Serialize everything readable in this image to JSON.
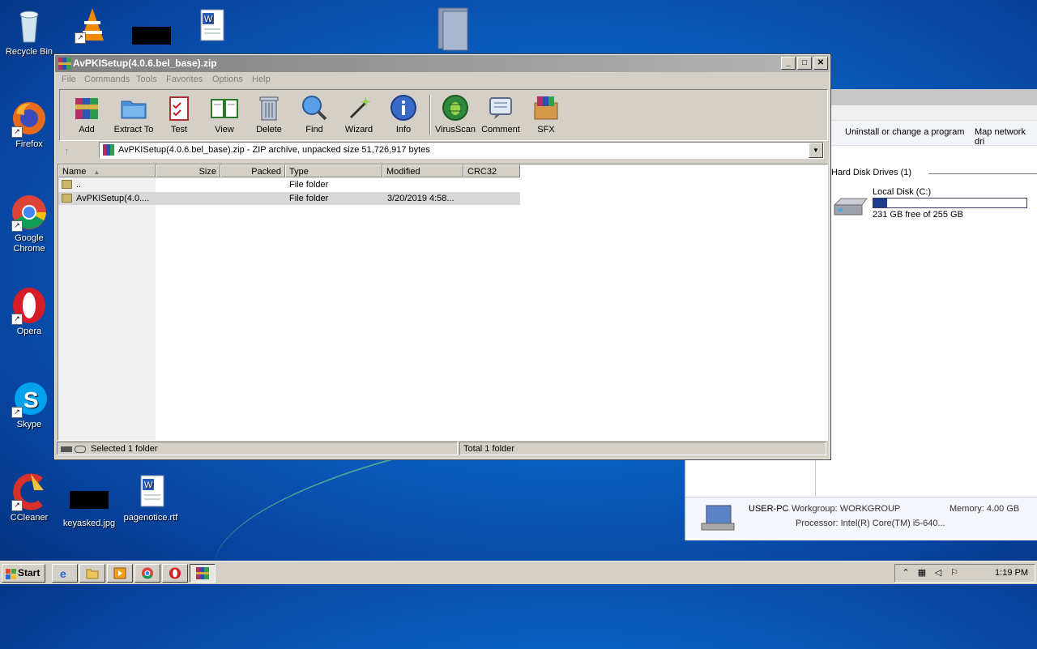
{
  "desktop": {
    "icons": [
      {
        "label": "Recycle Bin"
      },
      {
        "label": "Firefox"
      },
      {
        "label": "Google Chrome"
      },
      {
        "label": "Opera"
      },
      {
        "label": "Skype"
      },
      {
        "label": "CCleaner"
      },
      {
        "label": "keyasked.jpg"
      },
      {
        "label": "pagenotice.rtf"
      }
    ]
  },
  "bg_window": {
    "commands": [
      "Uninstall or change a program",
      "Map network dri"
    ],
    "section_title": "Hard Disk Drives (1)",
    "drive": {
      "name": "Local Disk (C:)",
      "free_text": "231 GB free of 255 GB",
      "used_fraction": 0.09
    },
    "info": {
      "pc_name": "USER-PC",
      "workgroup": "Workgroup: WORKGROUP",
      "memory": "Memory: 4.00 GB",
      "processor": "Processor: Intel(R) Core(TM) i5-640..."
    }
  },
  "winrar": {
    "title": "AvPKISetup(4.0.6.bel_base).zip",
    "menu": [
      "File",
      "Commands",
      "Tools",
      "Favorites",
      "Options",
      "Help"
    ],
    "toolbar": [
      "Add",
      "Extract To",
      "Test",
      "View",
      "Delete",
      "Find",
      "Wizard",
      "Info",
      "VirusScan",
      "Comment",
      "SFX"
    ],
    "address": "AvPKISetup(4.0.6.bel_base).zip - ZIP archive, unpacked size 51,726,917 bytes",
    "columns": [
      "Name",
      "Size",
      "Packed",
      "Type",
      "Modified",
      "CRC32"
    ],
    "rows": [
      {
        "name": "..",
        "size": "",
        "packed": "",
        "type": "File folder",
        "modified": "",
        "crc": ""
      },
      {
        "name": "AvPKISetup(4.0....",
        "size": "",
        "packed": "",
        "type": "File folder",
        "modified": "3/20/2019 4:58...",
        "crc": ""
      }
    ],
    "status_left": "Selected 1 folder",
    "status_right": "Total 1 folder"
  },
  "taskbar": {
    "start_label": "Start",
    "clock": "1:19 PM"
  }
}
